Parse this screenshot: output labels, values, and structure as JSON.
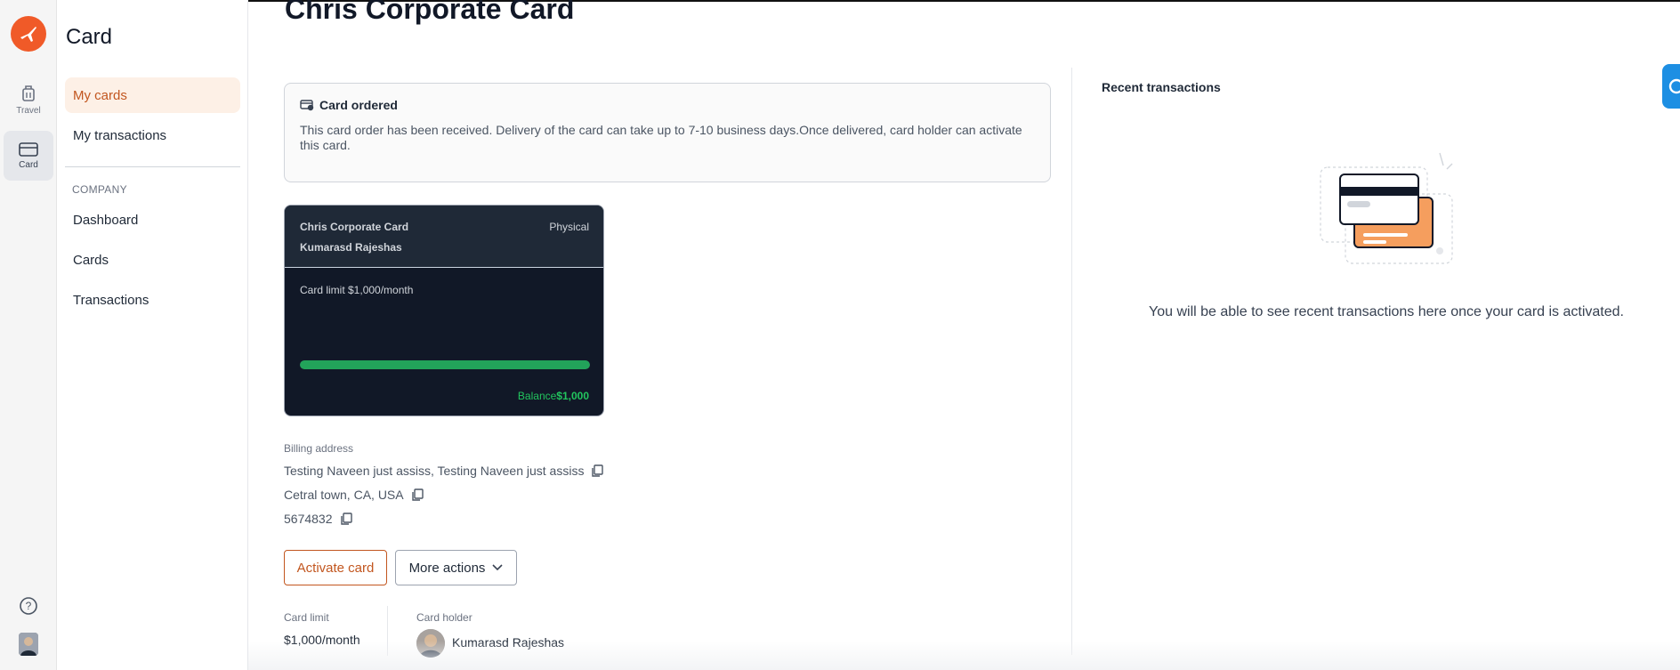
{
  "rail": {
    "items": [
      {
        "label": "Travel",
        "icon": "luggage-icon"
      },
      {
        "label": "Card",
        "icon": "card-icon",
        "active": true
      }
    ],
    "help_icon": "help-circle-icon",
    "avatar": "user-avatar"
  },
  "sidebar": {
    "title": "Card",
    "items": [
      {
        "label": "My cards",
        "active": true
      },
      {
        "label": "My transactions"
      }
    ],
    "section_label": "COMPANY",
    "company_items": [
      {
        "label": "Dashboard"
      },
      {
        "label": "Cards"
      },
      {
        "label": "Transactions"
      }
    ]
  },
  "main": {
    "title": "Chris Corporate Card",
    "notice": {
      "title": "Card ordered",
      "body": "This card order has been received. Delivery of the card can take up to 7-10 business days.Once delivered, card holder can activate this card."
    },
    "card": {
      "name": "Chris Corporate Card",
      "type": "Physical",
      "holder": "Kumarasd Rajeshas",
      "limit_text": "Card limit $1,000/month",
      "balance_label": "Balance",
      "balance_value": "$1,000",
      "balance_fraction": 1.0
    },
    "billing": {
      "label": "Billing address",
      "lines": [
        "Testing Naveen just assiss, Testing Naveen just assiss",
        "Cetral town, CA, USA",
        "5674832"
      ]
    },
    "buttons": {
      "activate": "Activate card",
      "more": "More actions"
    },
    "meta": {
      "limit_label": "Card limit",
      "limit_value": "$1,000/month",
      "holder_label": "Card holder",
      "holder_value": "Kumarasd Rajeshas"
    }
  },
  "recent": {
    "title": "Recent transactions",
    "empty_text": "You will be able to see recent transactions here once your card is activated."
  },
  "colors": {
    "accent": "#f05a28",
    "active_nav_bg": "#fdf0e6",
    "active_nav_text": "#c2561f",
    "card_bg": "#111827",
    "balance_green": "#22a35a"
  }
}
